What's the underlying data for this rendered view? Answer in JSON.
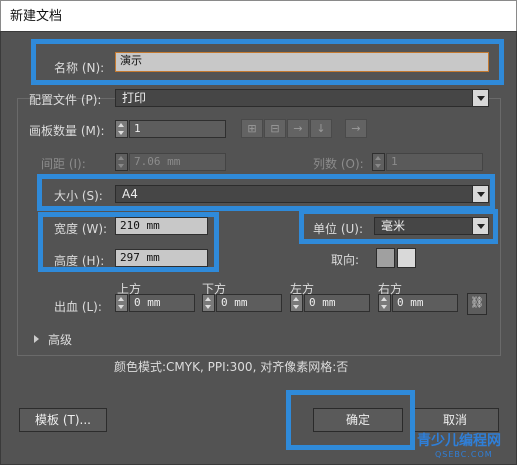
{
  "window": {
    "title": "新建文档"
  },
  "name_row": {
    "label": "名称 (N):",
    "value": "演示"
  },
  "profile": {
    "label": "配置文件 (P):",
    "value": "打印"
  },
  "artboards": {
    "count_label": "画板数量 (M):",
    "count_value": "1",
    "spacing_label": "间距 (I):",
    "spacing_value": "7.06 mm",
    "columns_label": "列数 (O):",
    "columns_value": "1"
  },
  "size": {
    "label": "大小 (S):",
    "value": "A4"
  },
  "width": {
    "label": "宽度 (W):",
    "value": "210 mm"
  },
  "height": {
    "label": "高度 (H):",
    "value": "297 mm"
  },
  "units": {
    "label": "单位 (U):",
    "value": "毫米"
  },
  "orientation": {
    "label": "取向:"
  },
  "bleed": {
    "label": "出血 (L):",
    "top_label": "上方",
    "top_value": "0 mm",
    "bottom_label": "下方",
    "bottom_value": "0 mm",
    "left_label": "左方",
    "left_value": "0 mm",
    "right_label": "右方",
    "right_value": "0 mm"
  },
  "advanced": {
    "label": "高级"
  },
  "summary": {
    "text": "颜色模式:CMYK, PPI:300, 对齐像素网格:否"
  },
  "buttons": {
    "templates": "模板 (T)...",
    "ok": "确定",
    "cancel": "取消"
  },
  "watermark": {
    "text": "青少儿编程网",
    "url": "QSEBC.COM"
  },
  "colors": {
    "highlight": "#2f8ad9",
    "dialog_bg": "#535353"
  }
}
